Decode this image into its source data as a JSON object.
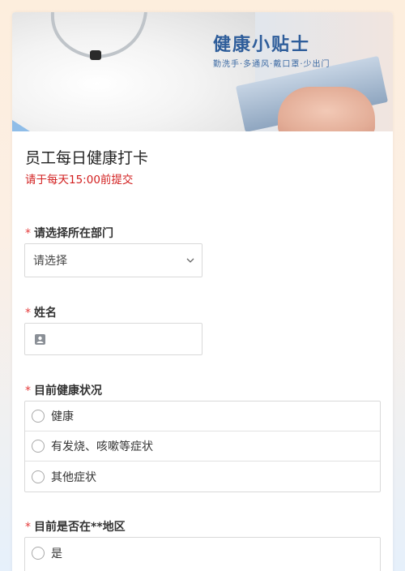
{
  "banner": {
    "title": "健康小贴士",
    "subtitle": "勤洗手·多通风·戴口罩·少出门"
  },
  "form": {
    "title": "员工每日健康打卡",
    "description": "请于每天15:00前提交"
  },
  "questions": {
    "department": {
      "required_mark": "*",
      "label": "请选择所在部门",
      "selected_value": "请选择"
    },
    "name": {
      "required_mark": "*",
      "label": "姓名",
      "value": "",
      "icon": "user-icon"
    },
    "health_status": {
      "required_mark": "*",
      "label": "目前健康状况",
      "options": [
        "健康",
        "有发烧、咳嗽等症状",
        "其他症状"
      ]
    },
    "in_area": {
      "required_mark": "*",
      "label": "目前是否在**地区",
      "options": [
        "是"
      ]
    }
  },
  "colors": {
    "required": "#e53b3b",
    "description": "#d21e1e",
    "banner_title": "#2e5d9a"
  }
}
